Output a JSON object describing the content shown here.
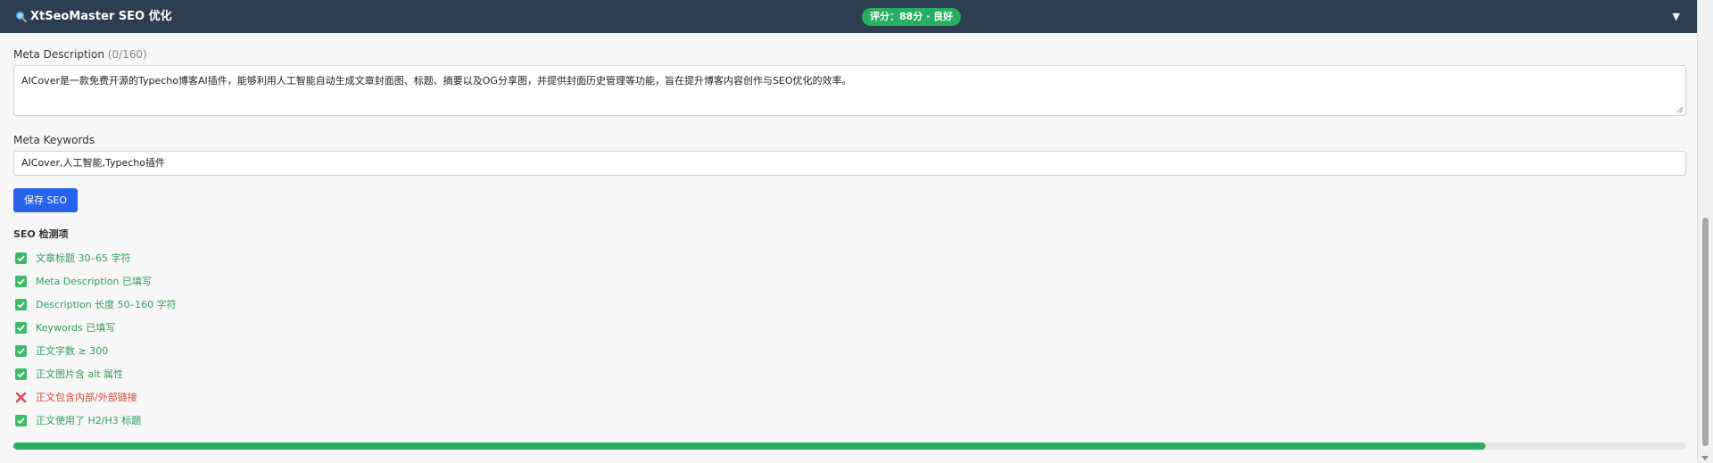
{
  "header": {
    "title": "XtSeoMaster SEO 优化",
    "score": "评分：88分 · 良好",
    "toggle": "▼",
    "accent": "#2d3e50"
  },
  "meta_description": {
    "label": "Meta Description",
    "count": "(0/160)",
    "value": "AICover是一款免费开源的Typecho博客AI插件，能够利用人工智能自动生成文章封面图、标题、摘要以及OG分享图，并提供封面历史管理等功能，旨在提升博客内容创作与SEO优化的效率。"
  },
  "meta_keywords": {
    "label": "Meta Keywords",
    "value": "AICover,人工智能,Typecho插件"
  },
  "save_button": "保存 SEO",
  "checks_title": "SEO 检测项",
  "checks": [
    {
      "label": "文章标题 30–65 字符",
      "status": "pass"
    },
    {
      "label": "Meta Description 已填写",
      "status": "pass"
    },
    {
      "label": "Description 长度 50–160 字符",
      "status": "pass"
    },
    {
      "label": "Keywords 已填写",
      "status": "pass"
    },
    {
      "label": "正文字数 ≥ 300",
      "status": "pass"
    },
    {
      "label": "正文图片含 alt 属性",
      "status": "pass"
    },
    {
      "label": "正文包含内部/外部链接",
      "status": "fail"
    },
    {
      "label": "正文使用了 H2/H3 标题",
      "status": "pass"
    }
  ],
  "progress": {
    "percent": 88
  },
  "colors": {
    "pass": "#2f9e5f",
    "fail": "#d9483b",
    "primary": "#2563eb",
    "progress": "#27ae60"
  }
}
